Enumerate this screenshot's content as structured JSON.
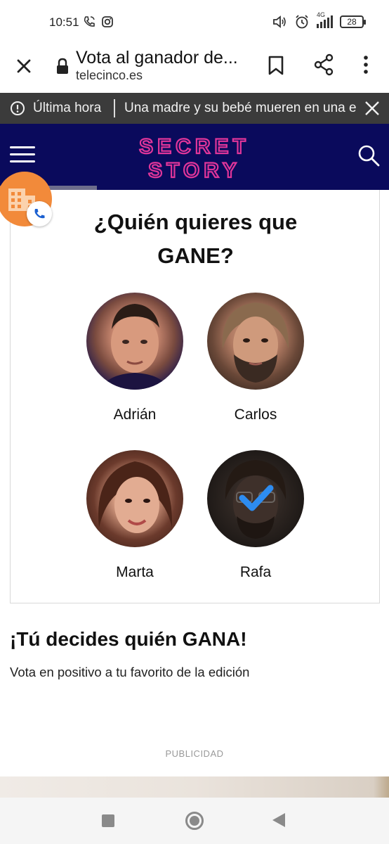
{
  "status_bar": {
    "time": "10:51",
    "network": "4G",
    "battery": "28",
    "icons": [
      "phone-wifi-icon",
      "instagram-icon",
      "volume-icon",
      "alarm-icon",
      "signal-icon",
      "battery-icon"
    ]
  },
  "browser": {
    "page_title": "Vota al ganador de...",
    "domain": "telecinco.es",
    "icons": [
      "close-icon",
      "lock-icon",
      "bookmark-icon",
      "share-icon",
      "more-options-icon"
    ]
  },
  "news_bar": {
    "label": "Última hora",
    "headline": "Una madre y su bebé mueren en una e",
    "icons": [
      "alert-icon",
      "close-icon"
    ]
  },
  "site_header": {
    "logo_line1": "SECRET",
    "logo_line2": "STORY",
    "colors": {
      "background": "#0a0a5c",
      "logo": "#e0359a"
    },
    "icons": [
      "menu-icon",
      "search-icon"
    ]
  },
  "poll": {
    "title_line1": "¿Quién quieres que",
    "title_line2": "GANE?",
    "candidates": [
      {
        "name": "Adrián",
        "selected": false
      },
      {
        "name": "Carlos",
        "selected": false
      },
      {
        "name": "Marta",
        "selected": false
      },
      {
        "name": "Rafa",
        "selected": true
      }
    ],
    "colors": {
      "check": "#2d8cf0"
    }
  },
  "cta": {
    "title": "¡Tú decides quién GANA!",
    "subtitle": "Vota en positivo a tu favorito de la edición"
  },
  "ad": {
    "label": "PUBLICIDAD"
  },
  "call_widget": {
    "colors": {
      "background": "#f28a3a",
      "badge_icon": "#1a5fd0"
    },
    "icons": [
      "building-icon",
      "phone-icon"
    ]
  },
  "nav_bar": {
    "icons": [
      "recents-icon",
      "home-icon",
      "back-icon"
    ]
  }
}
